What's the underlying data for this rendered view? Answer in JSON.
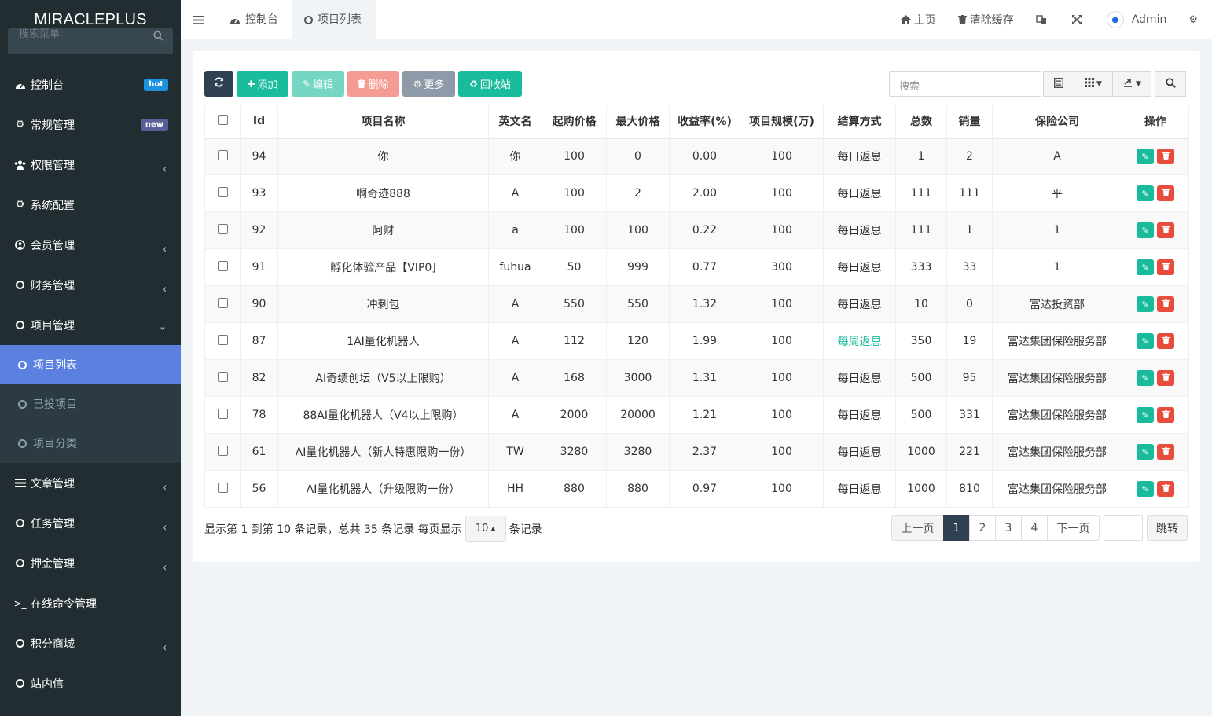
{
  "app": {
    "logo": "MIRACLEPLUS"
  },
  "sidebar": {
    "search_placeholder": "搜索菜单",
    "items": [
      {
        "label": "控制台",
        "badge": "hot"
      },
      {
        "label": "常规管理",
        "badge": "new"
      },
      {
        "label": "权限管理"
      },
      {
        "label": "系统配置"
      },
      {
        "label": "会员管理"
      },
      {
        "label": "财务管理"
      },
      {
        "label": "项目管理"
      },
      {
        "label": "文章管理"
      },
      {
        "label": "任务管理"
      },
      {
        "label": "押金管理"
      },
      {
        "label": "在线命令管理"
      },
      {
        "label": "积分商城"
      },
      {
        "label": "站内信"
      }
    ],
    "sub_items": [
      {
        "label": "项目列表"
      },
      {
        "label": "已投项目"
      },
      {
        "label": "项目分类"
      }
    ]
  },
  "navbar": {
    "tabs": [
      {
        "label": "控制台"
      },
      {
        "label": "项目列表"
      }
    ],
    "home": "主页",
    "clear_cache": "清除缓存",
    "user": "Admin"
  },
  "toolbar": {
    "add": "添加",
    "edit": "编辑",
    "delete": "删除",
    "more": "更多",
    "recycle": "回收站",
    "search_placeholder": "搜索"
  },
  "table": {
    "columns": [
      "Id",
      "项目名称",
      "英文名",
      "起购价格",
      "最大价格",
      "收益率(%)",
      "项目规模(万)",
      "结算方式",
      "总数",
      "销量",
      "保险公司",
      "操作"
    ],
    "rows": [
      {
        "id": "94",
        "name": "你",
        "en": "你",
        "min": "100",
        "max": "0",
        "rate": "0.00",
        "scale": "100",
        "settle": "每日返息",
        "total": "1",
        "sold": "2",
        "insurer": "A"
      },
      {
        "id": "93",
        "name": "啊奇迹888",
        "en": "A",
        "min": "100",
        "max": "2",
        "rate": "2.00",
        "scale": "100",
        "settle": "每日返息",
        "total": "111",
        "sold": "111",
        "insurer": "平"
      },
      {
        "id": "92",
        "name": "阿财",
        "en": "a",
        "min": "100",
        "max": "100",
        "rate": "0.22",
        "scale": "100",
        "settle": "每日返息",
        "total": "111",
        "sold": "1",
        "insurer": "1"
      },
      {
        "id": "91",
        "name": "孵化体验产品【VIP0]",
        "en": "fuhua",
        "min": "50",
        "max": "999",
        "rate": "0.77",
        "scale": "300",
        "settle": "每日返息",
        "total": "333",
        "sold": "33",
        "insurer": "1"
      },
      {
        "id": "90",
        "name": "冲刺包",
        "en": "A",
        "min": "550",
        "max": "550",
        "rate": "1.32",
        "scale": "100",
        "settle": "每日返息",
        "total": "10",
        "sold": "0",
        "insurer": "富达投资部"
      },
      {
        "id": "87",
        "name": "1AI量化机器人",
        "en": "A",
        "min": "112",
        "max": "120",
        "rate": "1.99",
        "scale": "100",
        "settle": "每周返息",
        "total": "350",
        "sold": "19",
        "insurer": "富达集团保险服务部"
      },
      {
        "id": "82",
        "name": "AI奇绩创坛（V5以上限购）",
        "en": "A",
        "min": "168",
        "max": "3000",
        "rate": "1.31",
        "scale": "100",
        "settle": "每日返息",
        "total": "500",
        "sold": "95",
        "insurer": "富达集团保险服务部"
      },
      {
        "id": "78",
        "name": "88AI量化机器人（V4以上限购）",
        "en": "A",
        "min": "2000",
        "max": "20000",
        "rate": "1.21",
        "scale": "100",
        "settle": "每日返息",
        "total": "500",
        "sold": "331",
        "insurer": "富达集团保险服务部"
      },
      {
        "id": "61",
        "name": "AI量化机器人（新人特惠限购一份）",
        "en": "TW",
        "min": "3280",
        "max": "3280",
        "rate": "2.37",
        "scale": "100",
        "settle": "每日返息",
        "total": "1000",
        "sold": "221",
        "insurer": "富达集团保险服务部"
      },
      {
        "id": "56",
        "name": "AI量化机器人（升级限购一份）",
        "en": "HH",
        "min": "880",
        "max": "880",
        "rate": "0.97",
        "scale": "100",
        "settle": "每日返息",
        "total": "1000",
        "sold": "810",
        "insurer": "富达集团保险服务部"
      }
    ]
  },
  "footer": {
    "info_prefix": "显示第 1 到第 10 条记录，总共 35 条记录 每页显示",
    "page_size": "10",
    "info_suffix": "条记录",
    "prev": "上一页",
    "pages": [
      "1",
      "2",
      "3",
      "4"
    ],
    "next": "下一页",
    "jump": "跳转"
  },
  "colors": {
    "sidebar_bg": "#222d32",
    "active_menu": "#5b80e0",
    "accent": "#18bc9c",
    "danger": "#e74c3c",
    "dark_btn": "#2f4050"
  }
}
